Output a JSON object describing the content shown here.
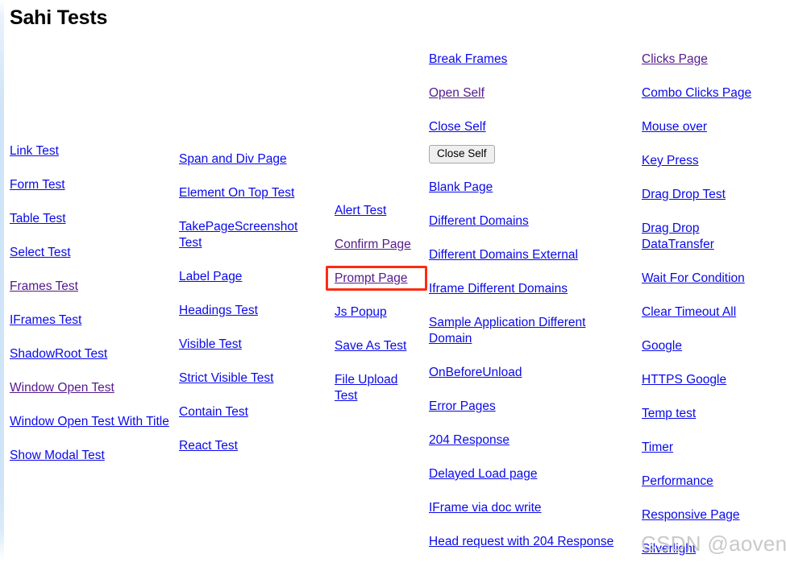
{
  "page": {
    "title": "Sahi Tests",
    "watermark": "CSDN @aovenus",
    "link_color": "#0a0ae8",
    "visited_link_color": "#551a8b",
    "highlight_color": "#fc2b13",
    "background": "#ffffff",
    "left_strip_color": "#cfe4f7"
  },
  "columns": [
    {
      "name": "column-1",
      "items": [
        {
          "label": "Link Test",
          "visited": false
        },
        {
          "label": "Form Test",
          "visited": false
        },
        {
          "label": "Table Test",
          "visited": false
        },
        {
          "label": "Select Test",
          "visited": false
        },
        {
          "label": "Frames Test",
          "visited": true
        },
        {
          "label": "IFrames Test",
          "visited": false
        },
        {
          "label": "ShadowRoot Test",
          "visited": false
        },
        {
          "label": "Window Open Test",
          "visited": true
        },
        {
          "label": "Window Open Test With Title",
          "visited": false
        },
        {
          "label": "Show Modal Test",
          "visited": false
        }
      ]
    },
    {
      "name": "column-2",
      "items": [
        {
          "label": "Span and Div Page",
          "visited": false
        },
        {
          "label": "Element On Top Test",
          "visited": false
        },
        {
          "label": "TakePageScreenshot Test",
          "visited": false
        },
        {
          "label": "Label Page",
          "visited": false
        },
        {
          "label": "Headings Test",
          "visited": false
        },
        {
          "label": "Visible Test",
          "visited": false
        },
        {
          "label": "Strict Visible Test",
          "visited": false
        },
        {
          "label": "Contain Test",
          "visited": false
        },
        {
          "label": "React Test",
          "visited": false
        }
      ]
    },
    {
      "name": "column-3",
      "items": [
        {
          "label": "Alert Test",
          "visited": false
        },
        {
          "label": "Confirm Page",
          "visited": true
        },
        {
          "label": "Prompt Page",
          "visited": true,
          "highlighted": true
        },
        {
          "label": "Js Popup",
          "visited": false
        },
        {
          "label": "Save As Test",
          "visited": false
        },
        {
          "label": "File Upload Test",
          "visited": false
        }
      ]
    },
    {
      "name": "column-4",
      "items": [
        {
          "label": "Break Frames",
          "visited": false
        },
        {
          "label": "Open Self",
          "visited": true
        },
        {
          "label": "Close Self",
          "visited": false
        },
        {
          "label": "Blank Page",
          "visited": false
        },
        {
          "label": "Different Domains",
          "visited": false
        },
        {
          "label": "Different Domains External",
          "visited": false
        },
        {
          "label": "Iframe Different Domains",
          "visited": false
        },
        {
          "label": "Sample Application Different Domain",
          "visited": false
        },
        {
          "label": "OnBeforeUnload",
          "visited": false
        },
        {
          "label": "Error Pages",
          "visited": false
        },
        {
          "label": "204 Response",
          "visited": false
        },
        {
          "label": "Delayed Load page",
          "visited": false
        },
        {
          "label": "IFrame via doc write",
          "visited": false
        },
        {
          "label": "Head request with 204 Response",
          "visited": false
        }
      ],
      "close_self_button": "Close Self"
    },
    {
      "name": "column-5",
      "items": [
        {
          "label": "Clicks Page",
          "visited": true
        },
        {
          "label": "Combo Clicks Page",
          "visited": false
        },
        {
          "label": "Mouse over",
          "visited": false
        },
        {
          "label": "Key Press",
          "visited": false
        },
        {
          "label": "Drag Drop Test",
          "visited": false
        },
        {
          "label": "Drag Drop DataTransfer",
          "visited": false
        },
        {
          "label": "Wait For Condition",
          "visited": false
        },
        {
          "label": "Clear Timeout All",
          "visited": false
        },
        {
          "label": "Google",
          "visited": false
        },
        {
          "label": "HTTPS Google",
          "visited": false
        },
        {
          "label": "Temp test",
          "visited": false
        },
        {
          "label": "Timer",
          "visited": false
        },
        {
          "label": "Performance",
          "visited": false
        },
        {
          "label": "Responsive Page",
          "visited": false
        },
        {
          "label": "Silverlight",
          "visited": false
        }
      ]
    }
  ]
}
